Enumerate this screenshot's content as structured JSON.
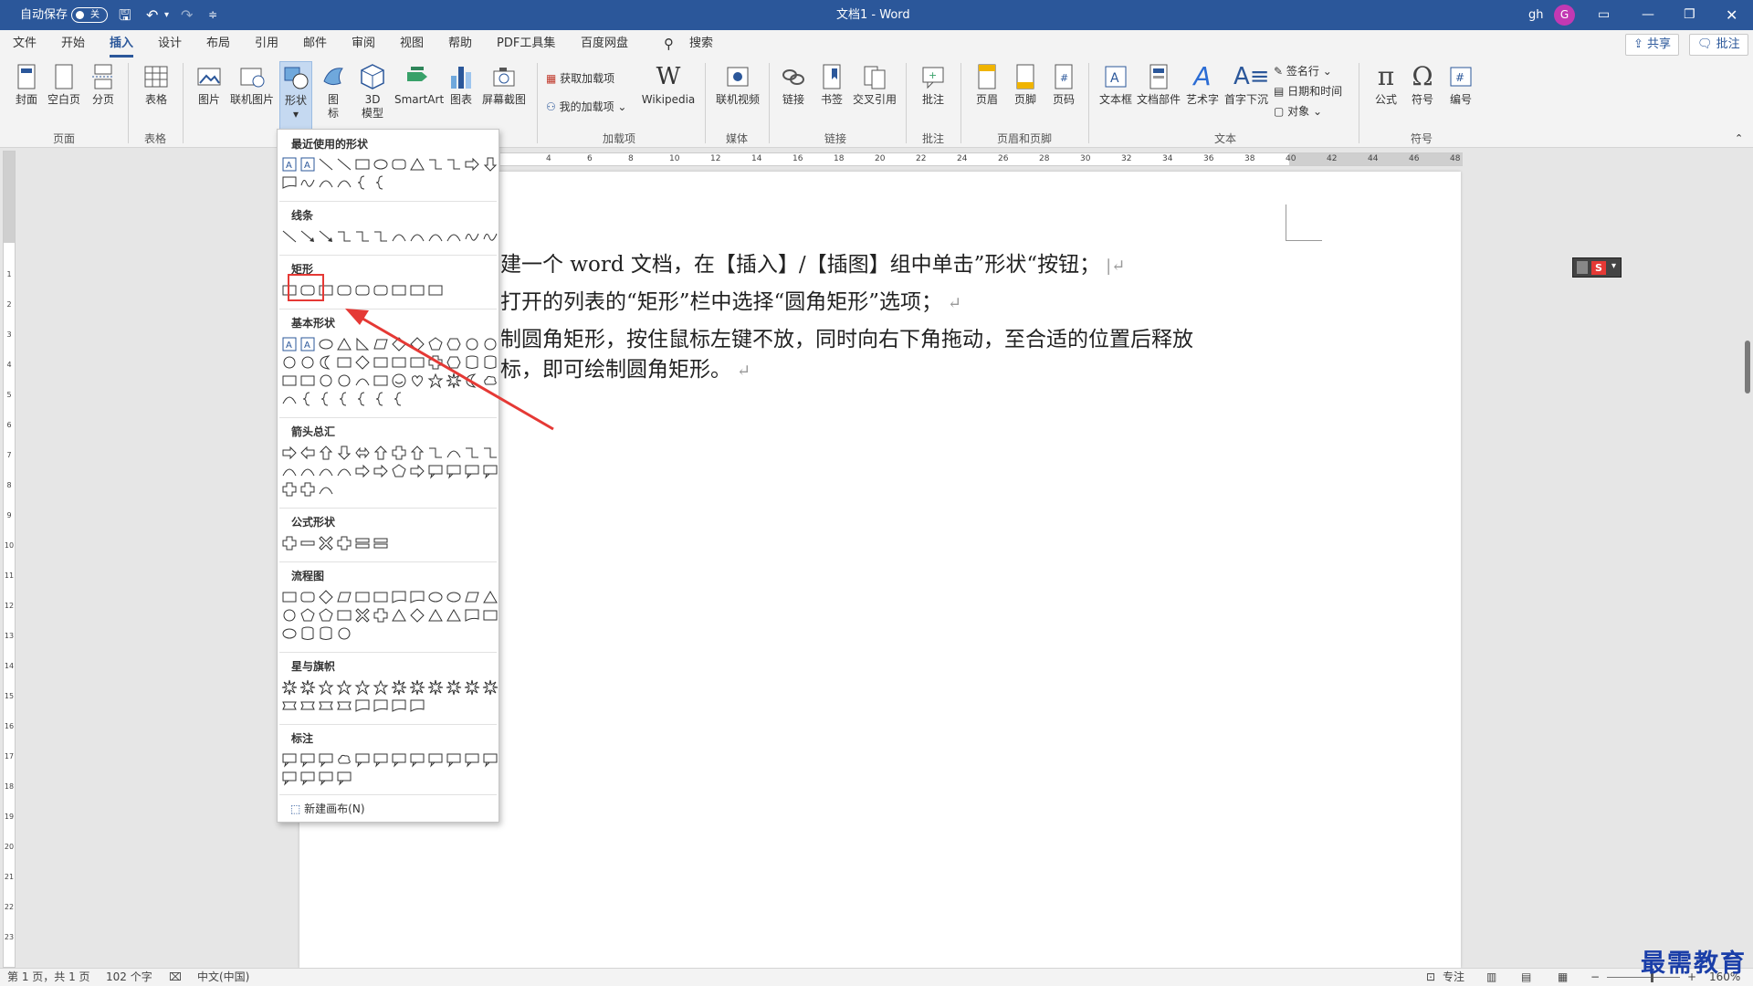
{
  "titlebar": {
    "autosave_label": "自动保存",
    "autosave_state": "关",
    "doc_title": "文档1 - Word",
    "user_name": "gh",
    "avatar_initial": "G"
  },
  "menu": {
    "tabs": [
      "文件",
      "开始",
      "插入",
      "设计",
      "布局",
      "引用",
      "邮件",
      "审阅",
      "视图",
      "帮助",
      "PDF工具集",
      "百度网盘"
    ],
    "active_tab": "插入",
    "search_label": "搜索",
    "share_label": "共享",
    "comment_label": "批注"
  },
  "ribbon": {
    "page": {
      "cover": "封面",
      "blank": "空白页",
      "break": "分页",
      "group": "页面"
    },
    "table": {
      "table": "表格",
      "group": "表格"
    },
    "illustrations": {
      "picture": "图片",
      "online_picture": "联机图片",
      "shapes": "形状",
      "icons_1": "图",
      "icons_2": "标",
      "model_1": "3D",
      "model_2": "模型",
      "smartart": "SmartArt",
      "chart": "图表",
      "screenshot": "屏幕截图"
    },
    "addins": {
      "get": "获取加载项",
      "my": "我的加载项",
      "wikipedia": "Wikipedia",
      "group": "加载项"
    },
    "media": {
      "video": "联机视频",
      "group": "媒体"
    },
    "links": {
      "link": "链接",
      "bookmark": "书签",
      "crossref": "交叉引用",
      "group": "链接"
    },
    "comments": {
      "comment": "批注",
      "group": "批注"
    },
    "header_footer": {
      "header": "页眉",
      "footer": "页脚",
      "page_number": "页码",
      "group": "页眉和页脚"
    },
    "text": {
      "textbox": "文本框",
      "quickparts": "文档部件",
      "wordart": "艺术字",
      "dropcap": "首字下沉",
      "signature": "签名行",
      "datetime": "日期和时间",
      "object": "对象",
      "group": "文本"
    },
    "symbols": {
      "equation": "公式",
      "symbol": "符号",
      "number": "编号",
      "group": "符号"
    }
  },
  "shapes_menu": {
    "sections": [
      "最近使用的形状",
      "线条",
      "矩形",
      "基本形状",
      "箭头总汇",
      "公式形状",
      "流程图",
      "星与旗帜",
      "标注"
    ],
    "new_canvas": "新建画布(N)"
  },
  "document": {
    "lines": [
      "建一个 word 文档，在【插入】/【插图】组中单击”形状“按钮；",
      "打开的列表的“矩形”栏中选择“圆角矩形”选项；",
      "制圆角矩形，按住鼠标左键不放，同时向右下角拖动，至合适的位置后释放",
      "标，即可绘制圆角矩形。"
    ]
  },
  "ruler_numbers": [
    "4",
    "6",
    "8",
    "10",
    "12",
    "14",
    "16",
    "18",
    "20",
    "22",
    "24",
    "26",
    "28",
    "30",
    "32",
    "34",
    "36",
    "38",
    "40",
    "42",
    "44",
    "46",
    "48"
  ],
  "vruler_numbers": [
    "1",
    "2",
    "3",
    "4",
    "5",
    "6",
    "7",
    "8",
    "9",
    "10",
    "11",
    "12",
    "13",
    "14",
    "15",
    "16",
    "17",
    "18",
    "19",
    "20",
    "21",
    "22",
    "23"
  ],
  "statusbar": {
    "page": "第 1 页，共 1 页",
    "words": "102 个字",
    "language": "中文(中国)",
    "focus": "专注",
    "zoom": "160%"
  },
  "watermark": "最需教育",
  "colors": {
    "accent": "#2b579a",
    "highlight": "#e53935"
  }
}
